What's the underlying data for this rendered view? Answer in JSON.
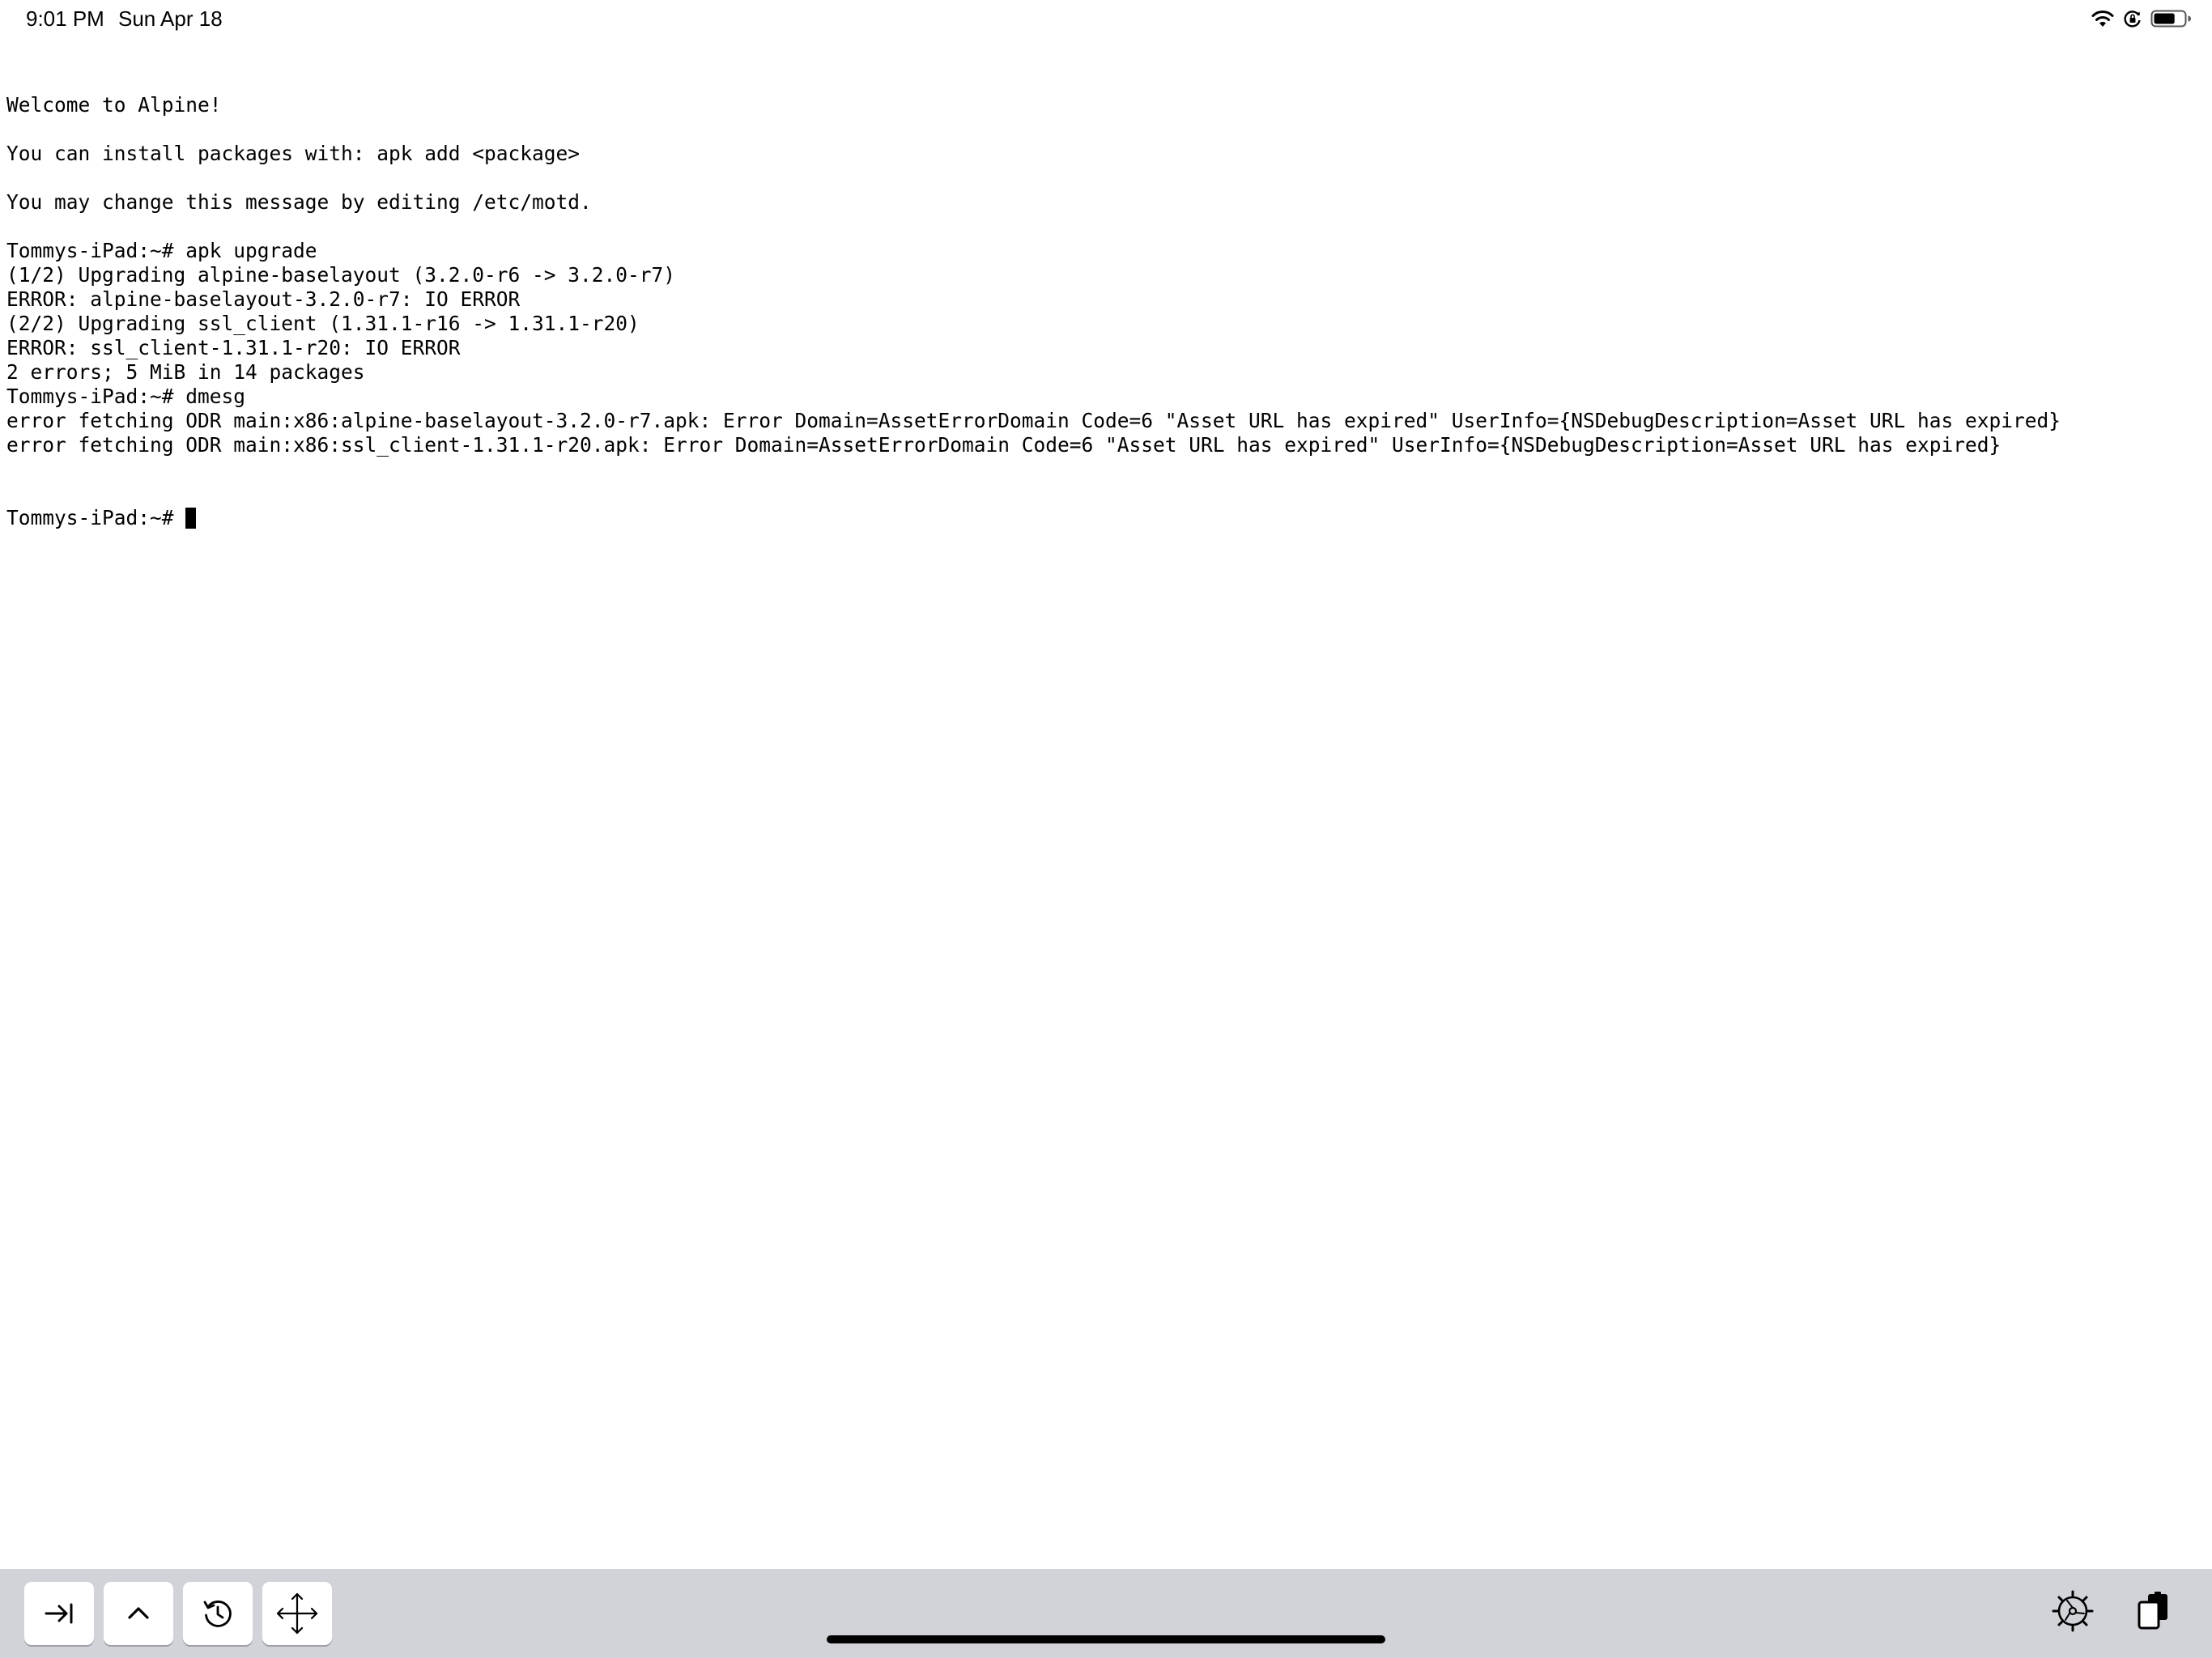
{
  "status_bar": {
    "time": "9:01 PM",
    "date": "Sun Apr 18",
    "icons": [
      "wifi-icon",
      "orientation-lock-icon",
      "battery-icon"
    ],
    "battery_level": 0.7
  },
  "terminal": {
    "lines": [
      "Welcome to Alpine!",
      "",
      "You can install packages with: apk add <package>",
      "",
      "You may change this message by editing /etc/motd.",
      "",
      "Tommys-iPad:~# apk upgrade",
      "(1/2) Upgrading alpine-baselayout (3.2.0-r6 -> 3.2.0-r7)",
      "ERROR: alpine-baselayout-3.2.0-r7: IO ERROR",
      "(2/2) Upgrading ssl_client (1.31.1-r16 -> 1.31.1-r20)",
      "ERROR: ssl_client-1.31.1-r20: IO ERROR",
      "2 errors; 5 MiB in 14 packages",
      "Tommys-iPad:~# dmesg",
      "error fetching ODR main:x86:alpine-baselayout-3.2.0-r7.apk: Error Domain=AssetErrorDomain Code=6 \"Asset URL has expired\" UserInfo={NSDebugDescription=Asset URL has expired}",
      "error fetching ODR main:x86:ssl_client-1.31.1-r20.apk: Error Domain=AssetErrorDomain Code=6 \"Asset URL has expired\" UserInfo={NSDebugDescription=Asset URL has expired}"
    ],
    "prompt": "Tommys-iPad:~# "
  },
  "toolbar": {
    "left_buttons": [
      "tab-key-icon",
      "control-key-icon",
      "history-icon",
      "arrow-keys-icon"
    ],
    "right_buttons": [
      "settings-icon",
      "paste-icon"
    ]
  },
  "colors": {
    "toolbar_background": "#d1d3d9",
    "terminal_background": "#ffffff",
    "terminal_text": "#000000"
  }
}
